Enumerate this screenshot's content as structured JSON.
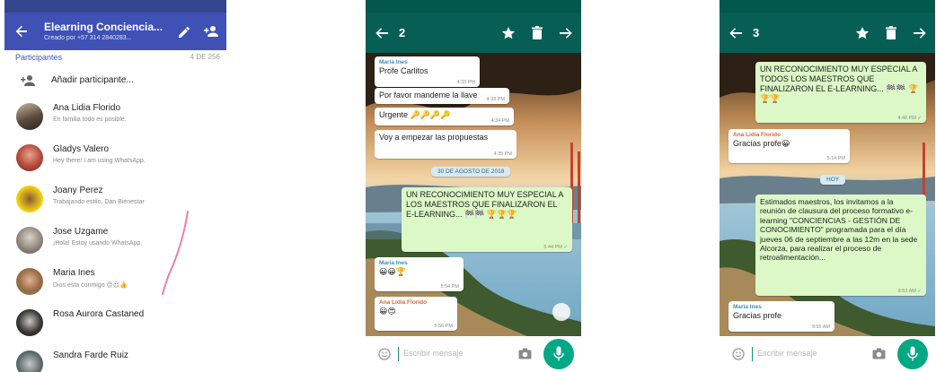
{
  "colors": {
    "indigo": "#3f51b5",
    "teal": "#075e54",
    "green_bubble": "#dcf8c6",
    "mic_green": "#00a884"
  },
  "group_info": {
    "title": "Elearning Conciencia...",
    "subtitle": "Creado por +57 314 2840283...",
    "section_label": "Participantes",
    "participant_count": "4 DE 256",
    "add_participant_label": "Añadir participante...",
    "participants": [
      {
        "name": "Ana Lidia Florido",
        "status": "En familia todo es posible."
      },
      {
        "name": "Gladys Valero",
        "status": "Hey there! I am using WhatsApp."
      },
      {
        "name": "Joany Perez",
        "status": "Trabajando estilo, Dan Bienestar"
      },
      {
        "name": "Jose Uzgame",
        "status": "¡Hola! Estoy usando WhatsApp."
      },
      {
        "name": "Maria Ines",
        "status": "Dios esta conmigo 😊😍👍"
      },
      {
        "name": "Rosa Aurora Castaned",
        "status": ""
      },
      {
        "name": "Sandra Farde Ruiz",
        "status": ""
      }
    ]
  },
  "chat2": {
    "selected_count": "2",
    "sender_maria": "Maria Ines",
    "msg1": "Profe Carlitos",
    "msg1_time": "4:33 PM",
    "msg2": "Por favor mandeme la llave",
    "msg2_time": "4:33 PM",
    "msg3": "Urgente 🔑🔑🔑🔑",
    "msg3_time": "4:34 PM",
    "msg4": "Voy a empezar las propuestas",
    "msg4_time": "4:35 PM",
    "date_chip": "30 DE AGOSTO DE 2018",
    "msg5": "UN RECONOCIMIENTO MUY ESPECIAL A LOS MAESTROS QUE FINALIZARON EL E-LEARNING... 🏁🏁 🏆🏆🏆",
    "msg5_time": "5:44 PM ✓",
    "msg6_sender": "Maria Ines",
    "msg6": "😀😀🏆",
    "msg6_time": "5:54 PM",
    "msg7_sender": "Ana Lidia Florido",
    "msg7": "😀😍",
    "msg7_time": "5:56 PM",
    "placeholder": "Escribir mensaje"
  },
  "chat3": {
    "selected_count": "3",
    "msg1": "UN RECONOCIMIENTO MUY ESPECIAL A TODOS LOS MAESTROS QUE FINALIZARON EL E-LEARNING... 🏁🏁 🏆🏆🏆",
    "msg1_time": "4:40 PM ✓",
    "msg2_sender": "Ana Lidia Florido",
    "msg2": "Gracias profe😀",
    "msg2_time": "5:14 PM",
    "date_chip": "HOY",
    "msg3": "Estimados maestros, los invitamos a la reunión de clausura del proceso formativo e-learning \"CONCIENCIAS - GESTIÓN DE CONOCIMIENTO\" programada para el día jueves 06 de septiembre a las 12m en la sede Alcorza, para realizar el proceso de retroalimentación...",
    "msg3_time": "9:53 AM ✓",
    "msg4_sender": "Maria Ines",
    "msg4": "Gracias profe",
    "msg4_time": "9:55 AM",
    "placeholder": "Escribir mensaje"
  }
}
